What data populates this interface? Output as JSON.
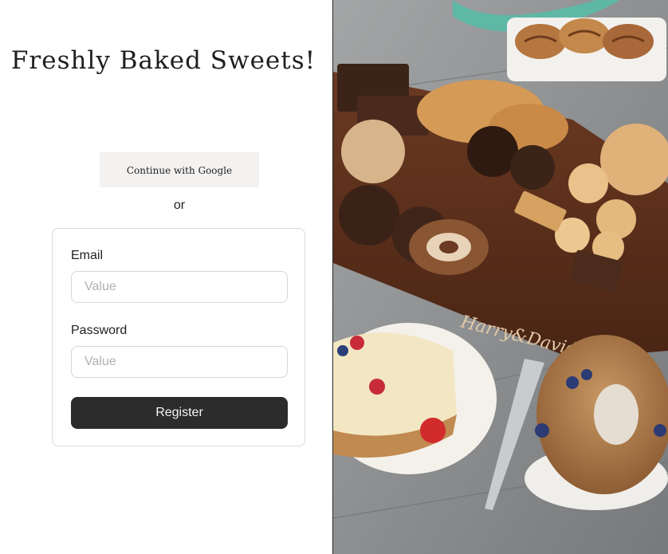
{
  "header": {
    "title": "Freshly Baked Sweets!"
  },
  "auth": {
    "google_button_label": "Continue with Google",
    "separator_text": "or"
  },
  "form": {
    "email_label": "Email",
    "email_placeholder": "Value",
    "password_label": "Password",
    "password_placeholder": "Value",
    "submit_label": "Register"
  },
  "hero_image": {
    "crate_branding": "Harry&David"
  },
  "colors": {
    "primary_button": "#2c2c2c",
    "google_button_bg": "#f4f2f1",
    "panel_divider": "#2a2a2a",
    "card_border": "#d9d9d9"
  }
}
